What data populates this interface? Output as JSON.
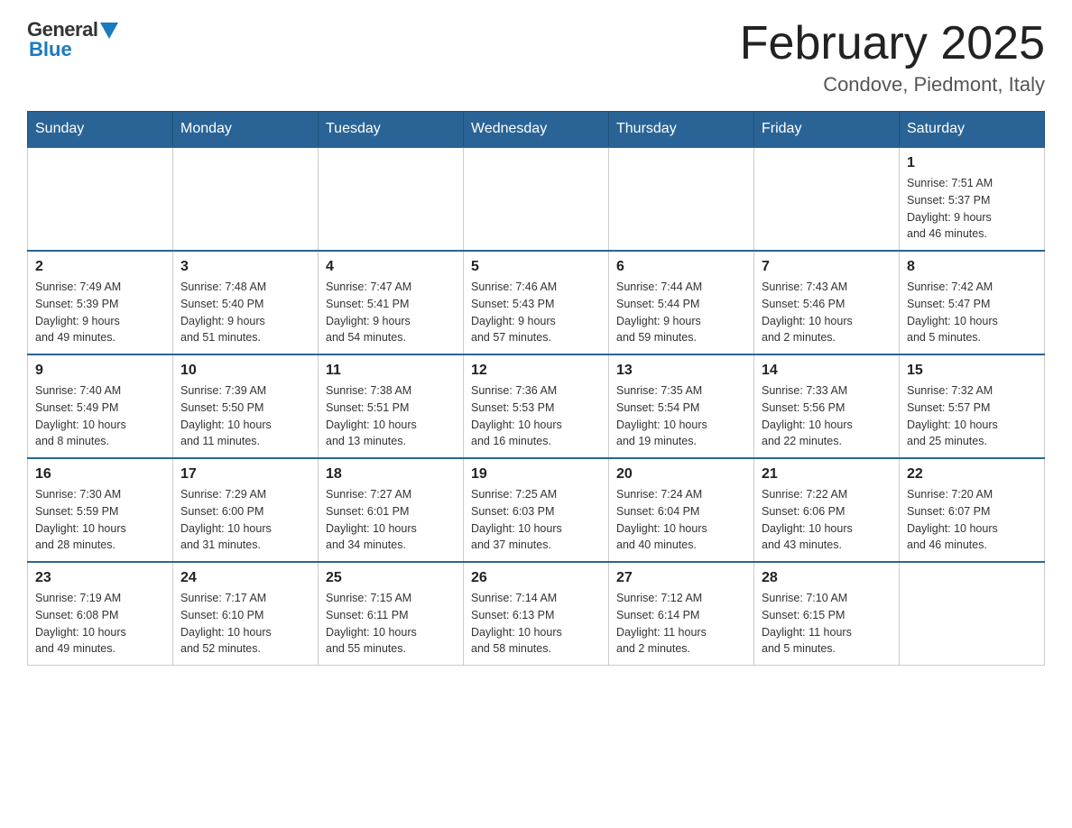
{
  "header": {
    "logo_general": "General",
    "logo_blue": "Blue",
    "month_title": "February 2025",
    "location": "Condove, Piedmont, Italy"
  },
  "days_of_week": [
    "Sunday",
    "Monday",
    "Tuesday",
    "Wednesday",
    "Thursday",
    "Friday",
    "Saturday"
  ],
  "weeks": [
    {
      "days": [
        {
          "num": "",
          "info": "",
          "empty": true
        },
        {
          "num": "",
          "info": "",
          "empty": true
        },
        {
          "num": "",
          "info": "",
          "empty": true
        },
        {
          "num": "",
          "info": "",
          "empty": true
        },
        {
          "num": "",
          "info": "",
          "empty": true
        },
        {
          "num": "",
          "info": "",
          "empty": true
        },
        {
          "num": "1",
          "info": "Sunrise: 7:51 AM\nSunset: 5:37 PM\nDaylight: 9 hours\nand 46 minutes.",
          "empty": false
        }
      ]
    },
    {
      "days": [
        {
          "num": "2",
          "info": "Sunrise: 7:49 AM\nSunset: 5:39 PM\nDaylight: 9 hours\nand 49 minutes.",
          "empty": false
        },
        {
          "num": "3",
          "info": "Sunrise: 7:48 AM\nSunset: 5:40 PM\nDaylight: 9 hours\nand 51 minutes.",
          "empty": false
        },
        {
          "num": "4",
          "info": "Sunrise: 7:47 AM\nSunset: 5:41 PM\nDaylight: 9 hours\nand 54 minutes.",
          "empty": false
        },
        {
          "num": "5",
          "info": "Sunrise: 7:46 AM\nSunset: 5:43 PM\nDaylight: 9 hours\nand 57 minutes.",
          "empty": false
        },
        {
          "num": "6",
          "info": "Sunrise: 7:44 AM\nSunset: 5:44 PM\nDaylight: 9 hours\nand 59 minutes.",
          "empty": false
        },
        {
          "num": "7",
          "info": "Sunrise: 7:43 AM\nSunset: 5:46 PM\nDaylight: 10 hours\nand 2 minutes.",
          "empty": false
        },
        {
          "num": "8",
          "info": "Sunrise: 7:42 AM\nSunset: 5:47 PM\nDaylight: 10 hours\nand 5 minutes.",
          "empty": false
        }
      ]
    },
    {
      "days": [
        {
          "num": "9",
          "info": "Sunrise: 7:40 AM\nSunset: 5:49 PM\nDaylight: 10 hours\nand 8 minutes.",
          "empty": false
        },
        {
          "num": "10",
          "info": "Sunrise: 7:39 AM\nSunset: 5:50 PM\nDaylight: 10 hours\nand 11 minutes.",
          "empty": false
        },
        {
          "num": "11",
          "info": "Sunrise: 7:38 AM\nSunset: 5:51 PM\nDaylight: 10 hours\nand 13 minutes.",
          "empty": false
        },
        {
          "num": "12",
          "info": "Sunrise: 7:36 AM\nSunset: 5:53 PM\nDaylight: 10 hours\nand 16 minutes.",
          "empty": false
        },
        {
          "num": "13",
          "info": "Sunrise: 7:35 AM\nSunset: 5:54 PM\nDaylight: 10 hours\nand 19 minutes.",
          "empty": false
        },
        {
          "num": "14",
          "info": "Sunrise: 7:33 AM\nSunset: 5:56 PM\nDaylight: 10 hours\nand 22 minutes.",
          "empty": false
        },
        {
          "num": "15",
          "info": "Sunrise: 7:32 AM\nSunset: 5:57 PM\nDaylight: 10 hours\nand 25 minutes.",
          "empty": false
        }
      ]
    },
    {
      "days": [
        {
          "num": "16",
          "info": "Sunrise: 7:30 AM\nSunset: 5:59 PM\nDaylight: 10 hours\nand 28 minutes.",
          "empty": false
        },
        {
          "num": "17",
          "info": "Sunrise: 7:29 AM\nSunset: 6:00 PM\nDaylight: 10 hours\nand 31 minutes.",
          "empty": false
        },
        {
          "num": "18",
          "info": "Sunrise: 7:27 AM\nSunset: 6:01 PM\nDaylight: 10 hours\nand 34 minutes.",
          "empty": false
        },
        {
          "num": "19",
          "info": "Sunrise: 7:25 AM\nSunset: 6:03 PM\nDaylight: 10 hours\nand 37 minutes.",
          "empty": false
        },
        {
          "num": "20",
          "info": "Sunrise: 7:24 AM\nSunset: 6:04 PM\nDaylight: 10 hours\nand 40 minutes.",
          "empty": false
        },
        {
          "num": "21",
          "info": "Sunrise: 7:22 AM\nSunset: 6:06 PM\nDaylight: 10 hours\nand 43 minutes.",
          "empty": false
        },
        {
          "num": "22",
          "info": "Sunrise: 7:20 AM\nSunset: 6:07 PM\nDaylight: 10 hours\nand 46 minutes.",
          "empty": false
        }
      ]
    },
    {
      "days": [
        {
          "num": "23",
          "info": "Sunrise: 7:19 AM\nSunset: 6:08 PM\nDaylight: 10 hours\nand 49 minutes.",
          "empty": false
        },
        {
          "num": "24",
          "info": "Sunrise: 7:17 AM\nSunset: 6:10 PM\nDaylight: 10 hours\nand 52 minutes.",
          "empty": false
        },
        {
          "num": "25",
          "info": "Sunrise: 7:15 AM\nSunset: 6:11 PM\nDaylight: 10 hours\nand 55 minutes.",
          "empty": false
        },
        {
          "num": "26",
          "info": "Sunrise: 7:14 AM\nSunset: 6:13 PM\nDaylight: 10 hours\nand 58 minutes.",
          "empty": false
        },
        {
          "num": "27",
          "info": "Sunrise: 7:12 AM\nSunset: 6:14 PM\nDaylight: 11 hours\nand 2 minutes.",
          "empty": false
        },
        {
          "num": "28",
          "info": "Sunrise: 7:10 AM\nSunset: 6:15 PM\nDaylight: 11 hours\nand 5 minutes.",
          "empty": false
        },
        {
          "num": "",
          "info": "",
          "empty": true
        }
      ]
    }
  ]
}
